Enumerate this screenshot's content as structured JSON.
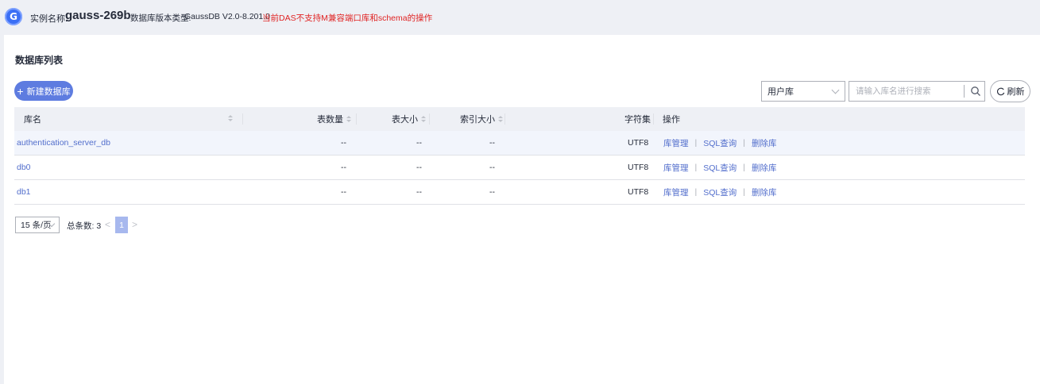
{
  "header": {
    "instance_label": "实例名称:",
    "instance_name": "gauss-269b",
    "version_label": "数据库版本类型:",
    "version_value": "GaussDB V2.0-8.201.0",
    "warning": "当前DAS不支持M兼容端口库和schema的操作",
    "logo_letter": "G"
  },
  "page": {
    "title": "数据库列表"
  },
  "toolbar": {
    "new_db_label": "新建数据库",
    "filter_select_value": "用户库",
    "search_placeholder": "请输入库名进行搜索",
    "refresh_label": "刷新"
  },
  "table": {
    "columns": {
      "name": "库名",
      "table_count": "表数量",
      "table_size": "表大小",
      "index_size": "索引大小",
      "charset": "字符集",
      "actions": "操作"
    },
    "rows": [
      {
        "name": "authentication_server_db",
        "table_count": "--",
        "table_size": "--",
        "index_size": "--",
        "charset": "UTF8"
      },
      {
        "name": "db0",
        "table_count": "--",
        "table_size": "--",
        "index_size": "--",
        "charset": "UTF8"
      },
      {
        "name": "db1",
        "table_count": "--",
        "table_size": "--",
        "index_size": "--",
        "charset": "UTF8"
      }
    ],
    "action_labels": {
      "manage": "库管理",
      "sql_query": "SQL查询",
      "delete": "删除库"
    }
  },
  "pagination": {
    "page_size": "15 条/页",
    "total": "总条数: 3",
    "prev": "<",
    "current_page": "1",
    "next": ">"
  },
  "colors": {
    "accent": "#5e7ce0",
    "link": "#526ecc",
    "warning": "#e02424",
    "header_bg": "#eef0f5"
  }
}
